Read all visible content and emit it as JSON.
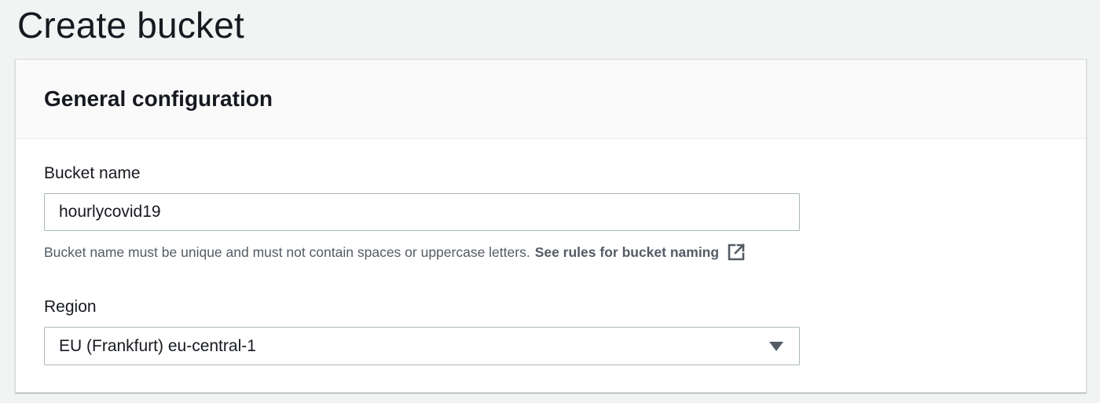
{
  "page": {
    "title": "Create bucket"
  },
  "general_configuration": {
    "heading": "General configuration",
    "bucket_name": {
      "label": "Bucket name",
      "value": "hourlycovid19",
      "hint": "Bucket name must be unique and must not contain spaces or uppercase letters.",
      "rules_link": "See rules for bucket naming",
      "link_icon": "external-link-icon"
    },
    "region": {
      "label": "Region",
      "selected": "EU (Frankfurt) eu-central-1",
      "dropdown_icon": "caret-down-icon"
    }
  },
  "colors": {
    "page_background": "#f2f3f3",
    "panel_background": "#ffffff",
    "panel_header_background": "#fafafa",
    "text_primary": "#16191f",
    "text_secondary": "#545b64",
    "input_border": "#aab7b8"
  }
}
